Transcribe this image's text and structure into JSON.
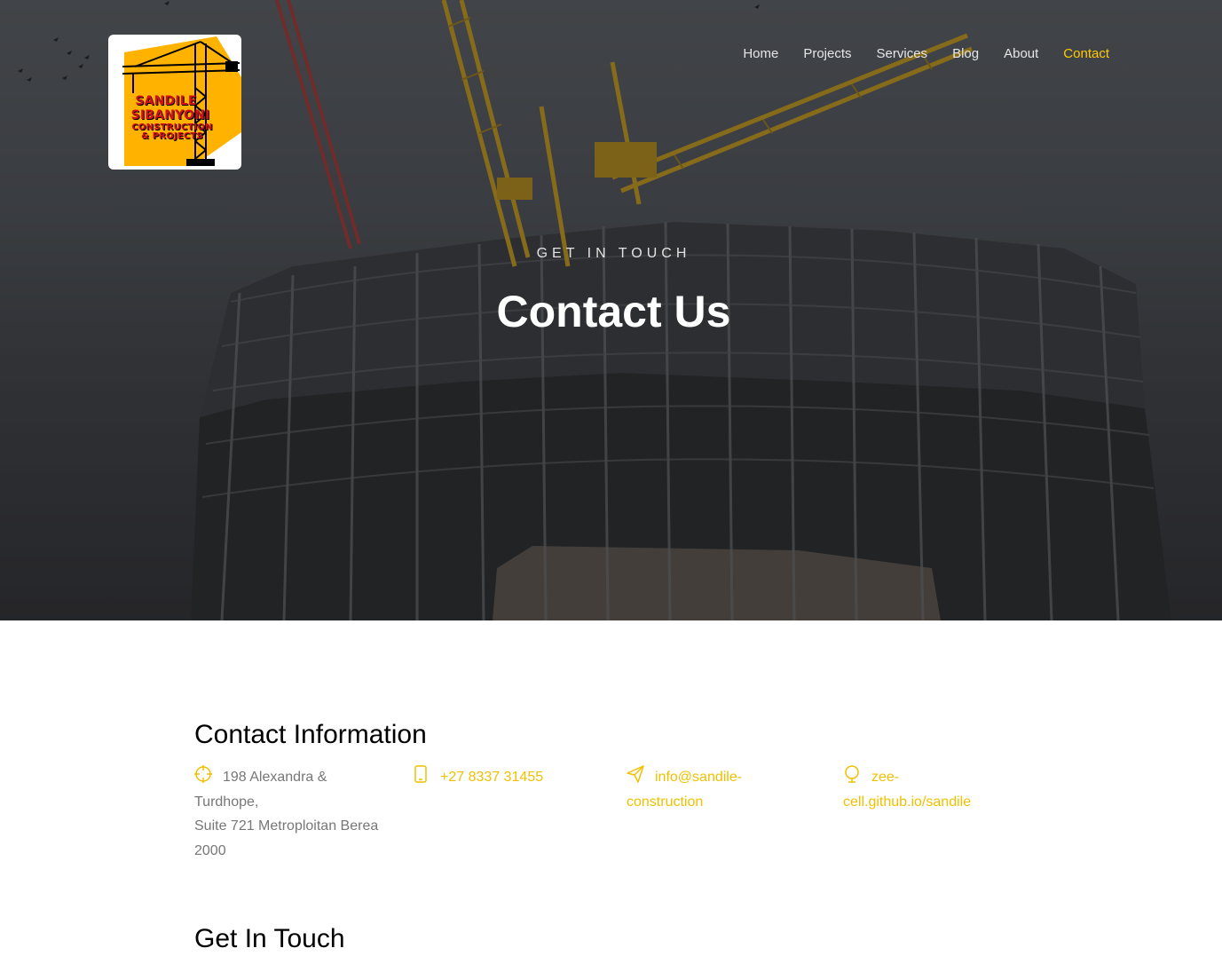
{
  "logo": {
    "line1": "SANDILE",
    "line2": "SIBANYONI",
    "line3": "CONSTRUCTION",
    "line4": "& PROJECTS"
  },
  "nav": {
    "items": [
      {
        "label": "Home"
      },
      {
        "label": "Projects"
      },
      {
        "label": "Services"
      },
      {
        "label": "Blog"
      },
      {
        "label": "About"
      },
      {
        "label": "Contact",
        "active": true
      }
    ]
  },
  "hero": {
    "kicker": "GET IN TOUCH",
    "title": "Contact Us"
  },
  "contact": {
    "heading": "Contact Information",
    "address": {
      "icon": "crosshair-icon",
      "line1": "198 Alexandra &",
      "line2": "Turdhope,",
      "line3": "Suite 721 Metroploitan Berea",
      "line4": "2000"
    },
    "phone": {
      "icon": "phone-icon",
      "value": "+27 8337 31455"
    },
    "email": {
      "icon": "paper-plane-icon",
      "line1": "info@sandile-",
      "line2": "construction"
    },
    "website": {
      "icon": "globe-icon",
      "line1": "zee-",
      "line2": "cell.github.io/sandile"
    }
  },
  "touch": {
    "heading": "Get In Touch"
  },
  "colors": {
    "accent": "#f0c000",
    "nav_active": "#ffcc00",
    "muted_text": "#777777"
  }
}
